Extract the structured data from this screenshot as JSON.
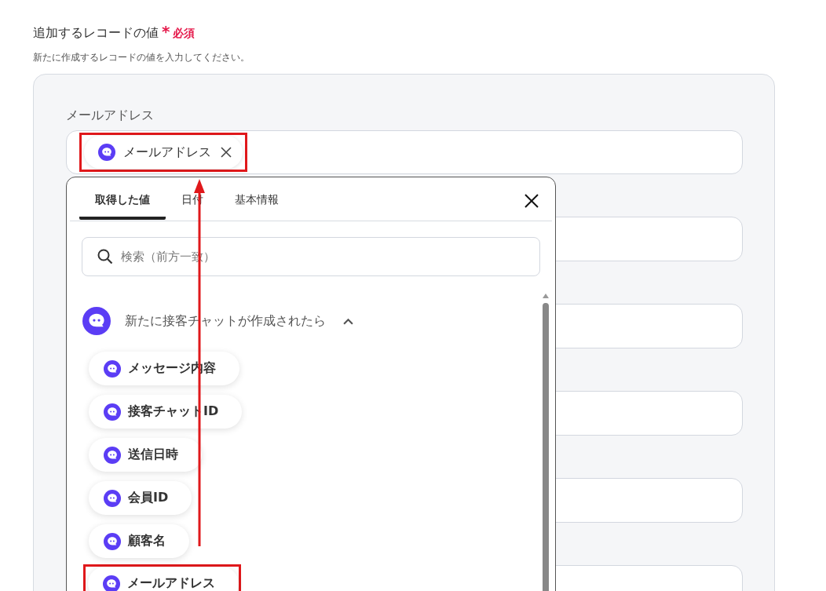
{
  "section": {
    "title": "追加するレコードの値",
    "required_mark": "*",
    "required_label": "必須",
    "description": "新たに作成するレコードの値を入力してください。"
  },
  "fields": [
    {
      "kind": "token",
      "label": "メールアドレス",
      "token": "メールアドレス",
      "highlighted": true
    },
    {
      "kind": "empty"
    },
    {
      "kind": "empty"
    },
    {
      "kind": "empty"
    },
    {
      "kind": "empty"
    },
    {
      "kind": "empty"
    }
  ],
  "popup": {
    "tabs": [
      {
        "label": "取得した値",
        "selected": true
      },
      {
        "label": "日付",
        "selected": false
      },
      {
        "label": "基本情報",
        "selected": false
      }
    ],
    "search": {
      "placeholder": "検索（前方一致）"
    },
    "group": {
      "title": "新たに接客チャットが作成されたら",
      "expanded": true
    },
    "items": [
      {
        "label": "メッセージ内容",
        "highlighted": false
      },
      {
        "label": "接客チャットID",
        "highlighted": false
      },
      {
        "label": "送信日時",
        "highlighted": false
      },
      {
        "label": "会員ID",
        "highlighted": false
      },
      {
        "label": "顧客名",
        "highlighted": false
      },
      {
        "label": "メールアドレス",
        "highlighted": true
      }
    ]
  }
}
